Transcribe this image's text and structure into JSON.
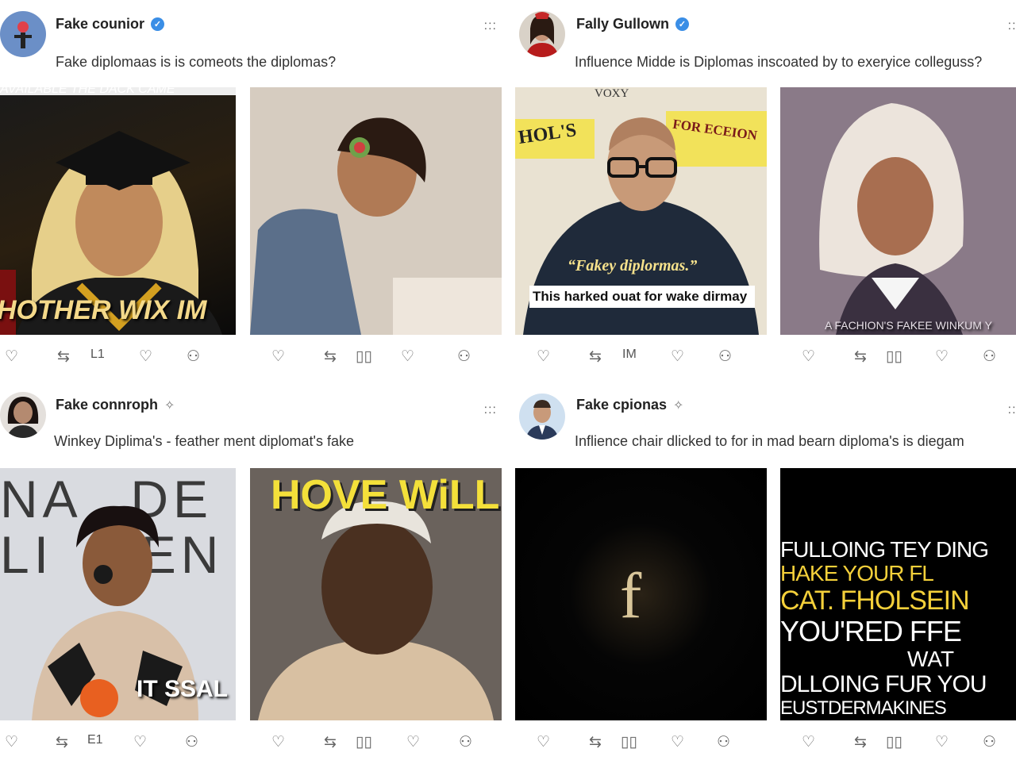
{
  "posts": [
    {
      "author": "Fake counior",
      "badge": "verified",
      "text": "Fake diplomaas is is comeots the diplomas?",
      "media": [
        {
          "caption": "HOTHER WIX IM",
          "top_caption": "AVAILABLE THE DACK CAME"
        },
        {
          "caption": ""
        }
      ],
      "actions": {
        "repost_count": "L1",
        "share_label": ""
      }
    },
    {
      "author": "Fally Gullown",
      "badge": "verified",
      "text": "Influence Midde is Diplomas inscoated by  to exeryice colleguss?",
      "media": [
        {
          "quote": "“Fakey diplormas.”",
          "subtitle": "This harked ouat for wake dirmay",
          "sign1": "HOL'S",
          "sign2": "FOR ECEION",
          "sign3": "VOXY"
        },
        {
          "caption": "A FACHION'S FAKEE WINKUM Y"
        }
      ],
      "actions": {
        "repost_count": "IM"
      }
    },
    {
      "author": "Fake connroph",
      "badge": "spark",
      "text": "Winkey Diplima's - feather ment diplomat's fake",
      "media": [
        {
          "caption": "IT SSAL",
          "backdrop": "NA DE LI FEN"
        },
        {
          "caption": "HOVE WiLL"
        }
      ],
      "actions": {
        "repost_count": "E1"
      }
    },
    {
      "author": "Fake cpionas",
      "badge": "spark",
      "text": "Inflience chair dlicked to for in mad bearn diploma's is diegam",
      "media": [
        {
          "glyph": "f"
        },
        {
          "collage_lines": [
            "FULLOING TEY DING",
            "HAKE YOUR FL",
            "CAT. FHOLSEIN",
            "YOU'RED FFE",
            "WAT",
            "DLLOING FUR YOU",
            "EUSTDERMAKINES"
          ]
        }
      ],
      "actions": {
        "repost_count": ""
      }
    }
  ],
  "icons": {
    "like": "heart-icon",
    "repost": "repost-icon",
    "stats": "stats-icon",
    "profile": "person-icon",
    "more": "more-dots-icon"
  },
  "more_glyph": ":::",
  "colors": {
    "verified": "#3a8ee6",
    "text": "#333333"
  }
}
